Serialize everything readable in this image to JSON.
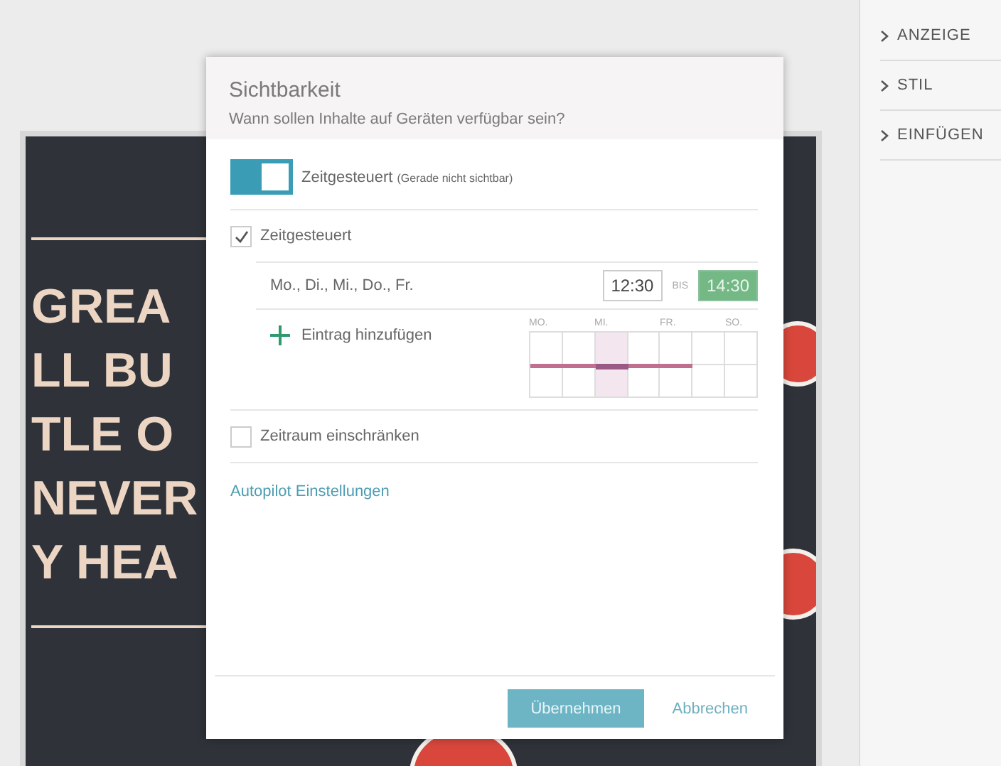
{
  "poster": {
    "lines": [
      "GREA",
      "LL BU",
      "TLE O",
      "NEVER",
      "Y HEA"
    ]
  },
  "side_panel": {
    "items": [
      {
        "label": "ANZEIGE",
        "expanded": false
      },
      {
        "label": "STIL",
        "expanded": false
      },
      {
        "label": "EINFÜGEN",
        "expanded": false
      }
    ]
  },
  "dialog": {
    "title": "Sichtbarkeit",
    "subtitle": "Wann sollen Inhalte auf Geräten verfügbar sein?",
    "toggle": {
      "on": true,
      "label": "Zeitgesteuert",
      "note": "(Gerade nicht sichtbar)"
    },
    "scheduled": {
      "checked": true,
      "label": "Zeitgesteuert"
    },
    "entry": {
      "days": "Mo., Di., Mi., Do., Fr.",
      "from": "12:30",
      "separator": "BIS",
      "to": "14:30",
      "to_selected": true
    },
    "add_entry": "Eintrag hinzufügen",
    "week": {
      "days": [
        {
          "label": "MO.",
          "active": true,
          "selected": false
        },
        {
          "active": true,
          "selected": false
        },
        {
          "label": "MI.",
          "active": true,
          "selected": true
        },
        {
          "active": true,
          "selected": false
        },
        {
          "label": "FR.",
          "active": true,
          "selected": false
        },
        {
          "active": false,
          "selected": false
        },
        {
          "label": "SO.",
          "active": false,
          "selected": false
        }
      ]
    },
    "restrict": {
      "checked": false,
      "label": "Zeitraum einschränken"
    },
    "link": "Autopilot Einstellungen",
    "buttons": [
      {
        "label": "Übernehmen",
        "kind": "primary"
      },
      {
        "label": "Abbrechen",
        "kind": "text"
      }
    ]
  }
}
